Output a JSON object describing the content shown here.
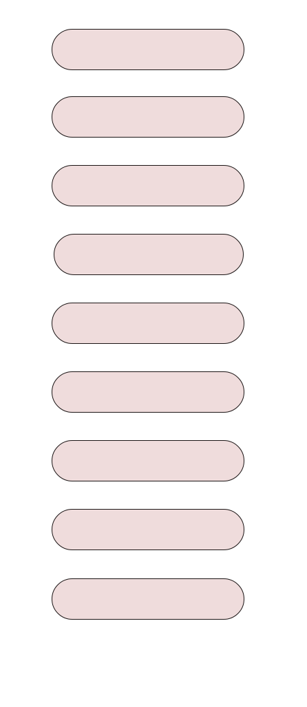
{
  "colors": {
    "fill": "#efdcdc",
    "stroke": "#1a1414"
  },
  "shapes": [
    {
      "type": "pill"
    },
    {
      "type": "pill"
    },
    {
      "type": "pill"
    },
    {
      "type": "pill"
    },
    {
      "type": "pill"
    },
    {
      "type": "pill"
    },
    {
      "type": "pill"
    },
    {
      "type": "pill"
    },
    {
      "type": "pill"
    }
  ]
}
